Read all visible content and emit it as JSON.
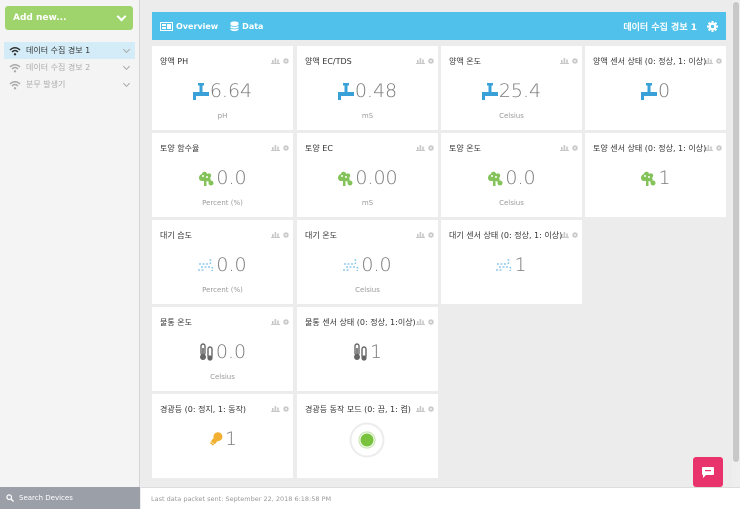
{
  "sidebar": {
    "add_new_label": "Add new...",
    "devices": [
      {
        "label": "데이터 수집 경보 1",
        "active": true
      },
      {
        "label": "데이터 수집 경보 2",
        "active": false
      },
      {
        "label": "분무 발생기",
        "active": false
      }
    ],
    "search_label": "Search Devices"
  },
  "topbar": {
    "tabs": [
      {
        "label": "Overview",
        "icon": "dashboard-icon"
      },
      {
        "label": "Data",
        "icon": "database-icon"
      }
    ],
    "device_title": "데이터 수집 경보 1"
  },
  "tiles": [
    {
      "title": "양액 PH",
      "value": "6.64",
      "unit": "pH",
      "icon": "pipe-icon"
    },
    {
      "title": "양액 EC/TDS",
      "value": "0.48",
      "unit": "mS",
      "icon": "pipe-icon"
    },
    {
      "title": "양액 온도",
      "value": "25.4",
      "unit": "Celsius",
      "icon": "pipe-icon"
    },
    {
      "title": "양액 센서 상태 (0: 정상, 1: 이상)",
      "value": "0",
      "unit": "",
      "icon": "pipe-icon"
    },
    {
      "title": "토양 함수율",
      "value": "0.0",
      "unit": "Percent (%)",
      "icon": "plant-icon"
    },
    {
      "title": "토양 EC",
      "value": "0.00",
      "unit": "mS",
      "icon": "plant-icon"
    },
    {
      "title": "토양 온도",
      "value": "0.0",
      "unit": "Celsius",
      "icon": "plant-icon"
    },
    {
      "title": "토양 센서 상태 (0: 정상, 1: 이상)",
      "value": "1",
      "unit": "",
      "icon": "plant-icon"
    },
    {
      "title": "대기 습도",
      "value": "0.0",
      "unit": "Percent (%)",
      "icon": "wind-icon"
    },
    {
      "title": "대기 온도",
      "value": "0.0",
      "unit": "Celsius",
      "icon": "wind-icon"
    },
    {
      "title": "대기 센서 상태 (0: 정상, 1: 이상)",
      "value": "1",
      "unit": "",
      "icon": "wind-icon"
    },
    {
      "title": "물통 온도",
      "value": "0.0",
      "unit": "Celsius",
      "icon": "thermometer-icon"
    },
    {
      "title": "물통 센서 상태 (0: 정상, 1:이상)",
      "value": "1",
      "unit": "",
      "icon": "thermometer-icon"
    },
    {
      "title": "경광등 (0: 정지, 1: 동작)",
      "value": "1",
      "unit": "",
      "icon": "bulb-icon"
    },
    {
      "title": "경광등 동작 모드 (0: 끔, 1: 켬)",
      "value": "",
      "unit": "",
      "icon": "status-led-icon"
    }
  ],
  "footer": {
    "last_packet": "Last data packet sent: September 22, 2018 6:18:58 PM"
  },
  "colors": {
    "accent": "#4fc1ea",
    "add_button": "#9ed46b",
    "pipe": "#3aa0d8",
    "plant": "#84c25a",
    "wind": "#79c1e8",
    "thermo": "#666666",
    "bulb": "#f1b031",
    "led": "#79c33e",
    "chat": "#e8336c"
  }
}
